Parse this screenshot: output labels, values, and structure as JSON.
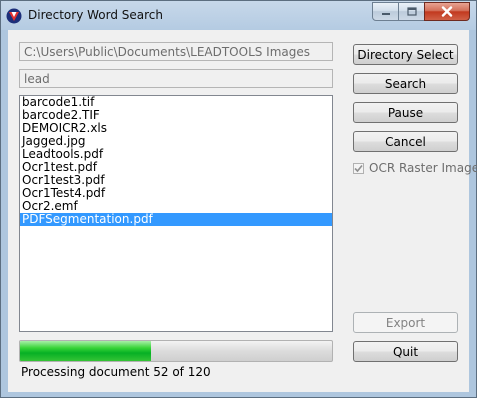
{
  "window": {
    "title": "Directory Word Search",
    "controls": [
      "minimize-icon",
      "maximize-icon",
      "close-icon"
    ]
  },
  "fields": {
    "directory_value": "C:\\Users\\Public\\Documents\\LEADTOOLS Images",
    "search_value": "lead"
  },
  "files": [
    "barcode1.tif",
    "barcode2.TIF",
    "DEMOICR2.xls",
    "Jagged.jpg",
    "Leadtools.pdf",
    "Ocr1test.pdf",
    "Ocr1test3.pdf",
    "Ocr1Test4.pdf",
    "Ocr2.emf",
    "PDFSegmentation.pdf"
  ],
  "selected_file": "PDFSegmentation.pdf",
  "buttons": {
    "directory_select": "Directory Select",
    "search": "Search",
    "pause": "Pause",
    "cancel": "Cancel",
    "export": "Export",
    "quit": "Quit"
  },
  "options": {
    "ocr_raster_label": "OCR Raster Images",
    "ocr_raster_checked": true,
    "ocr_raster_enabled": false
  },
  "progress": {
    "current": 52,
    "total": 120,
    "fraction": 0.42,
    "status_text": "Processing document 52 of 120"
  },
  "colors": {
    "selection": "#3399ff",
    "progress_green": "#06b025"
  }
}
